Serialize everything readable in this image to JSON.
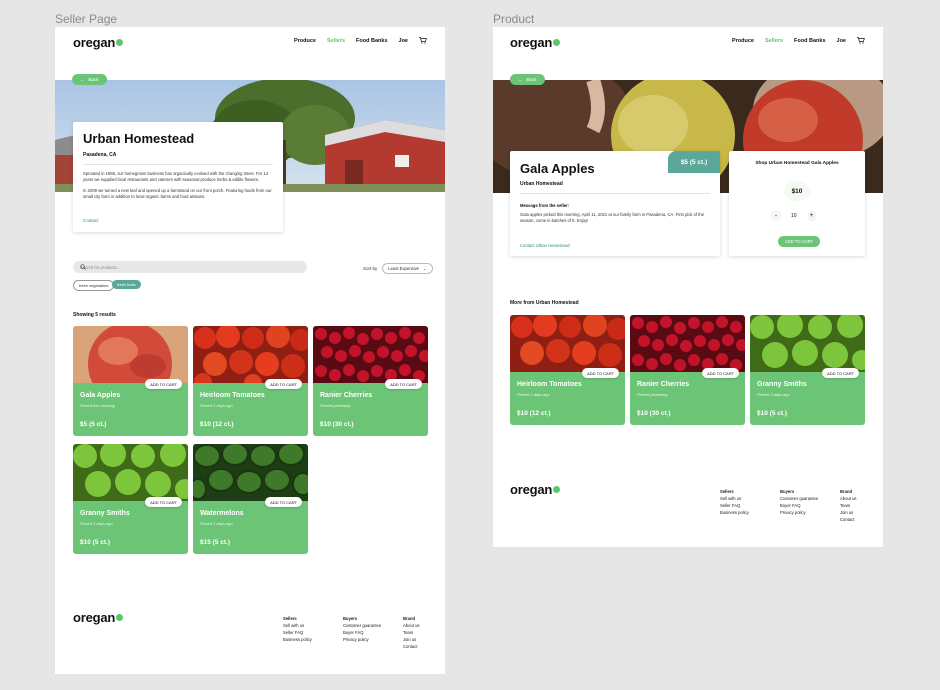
{
  "labels": {
    "seller_frame": "Seller Page",
    "product_frame": "Product"
  },
  "brand": {
    "logo": "oregan",
    "accent": "#5cc76a",
    "teal": "#5ba79a"
  },
  "nav": {
    "produce": "Produce",
    "sellers": "Sellers",
    "food_banks": "Food Banks",
    "user": "Joe"
  },
  "back_label": "Back",
  "seller": {
    "name": "Urban Homestead",
    "location": "Pasadena, CA",
    "bio_1": "Sprouted in 1995, our homegrown business has organically evolved with the changing times. For 14 years we supplied local restaurants and caterers with seasonal produce herbs & edible flowers.",
    "bio_2": "In 2009 we turned a new leaf and opened up a farmstand on our front porch. Featuring foods from our small city farm in addition to local organic farms and food artisans.",
    "contact": "Contact"
  },
  "search": {
    "placeholder": "Search for products...",
    "sort_label": "Sort by",
    "sort_value": "Least Expensive",
    "chips": [
      "fresh vegetables",
      "fresh fruits"
    ],
    "results": "Showing 5 results"
  },
  "add_to_cart": "ADD TO CART",
  "products": [
    {
      "name": "Gala Apples",
      "picked": "Picked this morning",
      "price": "$5 (5 ct.)"
    },
    {
      "name": "Heirloom Tomatoes",
      "picked": "Picked 2 days ago",
      "price": "$10 (12 ct.)"
    },
    {
      "name": "Ranier Cherries",
      "picked": "Picked yesterday",
      "price": "$10 (30 ct.)"
    },
    {
      "name": "Granny Smiths",
      "picked": "Picked 3 days ago",
      "price": "$10 (5 ct.)"
    },
    {
      "name": "Watermelons",
      "picked": "Picked 2 days ago",
      "price": "$15 (5 ct.)"
    }
  ],
  "footer": {
    "sellers": {
      "title": "Sellers",
      "items": [
        "Sell with us",
        "Seller FAQ",
        "Business policy"
      ]
    },
    "buyers": {
      "title": "Buyers",
      "items": [
        "Customer guarantee",
        "Buyer FAQ",
        "Privacy policy"
      ]
    },
    "brand": {
      "title": "Brand",
      "items": [
        "About us",
        "Team",
        "Join us",
        "Contact"
      ]
    }
  },
  "product_page": {
    "name": "Gala Apples",
    "price_badge": "$5 (5 ct.)",
    "seller": "Urban Homestead",
    "message_title": "Message from the seller:",
    "message": "Gala apples picked this morning, April 11, 2021 at our family farm in Pasadena, CA. First pick of the season, come in batches of 5. Enjoy!",
    "contact": "Contact Urban Homestead",
    "shop_title": "Shop Urban Homestead Gala Apples",
    "price": "$10",
    "qty_minus": "-",
    "qty_value": "10",
    "qty_plus": "+",
    "add_button": "ADD TO CART",
    "more_title": "More from Urban Homestead",
    "more": [
      {
        "name": "Heirloom Tomatoes",
        "picked": "Picked 2 days ago",
        "price": "$10 (12 ct.)"
      },
      {
        "name": "Ranier Cherries",
        "picked": "Picked yesterday",
        "price": "$10 (30 ct.)"
      },
      {
        "name": "Granny Smiths",
        "picked": "Picked 3 days ago",
        "price": "$10 (5 ct.)"
      }
    ]
  }
}
